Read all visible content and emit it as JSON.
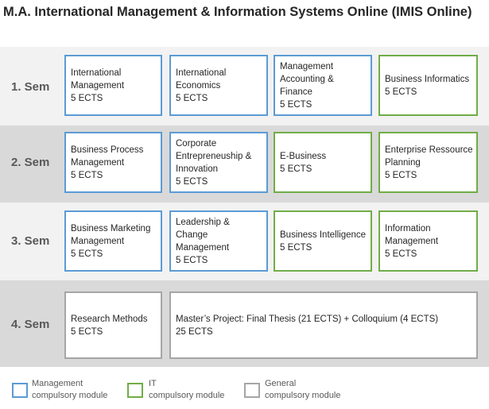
{
  "title": "M.A. International Management & Information Systems Online (IMIS Online)",
  "colors": {
    "management": "#5b9bd5",
    "it": "#70ad47",
    "general": "#a6a6a6",
    "band_light": "#f2f2f2",
    "band_dark": "#d9d9d9"
  },
  "semesters": [
    {
      "label": "1. Sem",
      "modules": [
        {
          "type": "management",
          "name": "International Management",
          "ects": "5 ECTS"
        },
        {
          "type": "management",
          "name": "International Economics",
          "ects": "5 ECTS"
        },
        {
          "type": "management",
          "name": "Management Accounting & Finance",
          "ects": "5 ECTS"
        },
        {
          "type": "it",
          "name": "Business Informatics",
          "ects": "5 ECTS"
        }
      ]
    },
    {
      "label": "2. Sem",
      "modules": [
        {
          "type": "management",
          "name": "Business Process Management",
          "ects": "5 ECTS"
        },
        {
          "type": "management",
          "name": "Corporate Entrepreneuship & Innovation",
          "ects": "5 ECTS"
        },
        {
          "type": "it",
          "name": "E-Business",
          "ects": "5 ECTS"
        },
        {
          "type": "it",
          "name": "Enterprise Ressource Planning",
          "ects": "5 ECTS"
        }
      ]
    },
    {
      "label": "3. Sem",
      "modules": [
        {
          "type": "management",
          "name": "Business Marketing Management",
          "ects": "5 ECTS"
        },
        {
          "type": "management",
          "name": "Leadership & Change Management",
          "ects": "5 ECTS"
        },
        {
          "type": "it",
          "name": "Business Intelligence",
          "ects": "5 ECTS"
        },
        {
          "type": "it",
          "name": "Information Management",
          "ects": "5 ECTS"
        }
      ]
    },
    {
      "label": "4. Sem",
      "modules": [
        {
          "type": "general",
          "name": "Research Methods",
          "ects": "5 ECTS"
        },
        {
          "type": "general",
          "name": "Master’s Project: Final Thesis (21 ECTS) + Colloquium (4 ECTS)",
          "ects": "25 ECTS"
        }
      ]
    }
  ],
  "legend": [
    {
      "type": "management",
      "line1": "Management",
      "line2": "compulsory module"
    },
    {
      "type": "it",
      "line1": "IT",
      "line2": "compulsory module"
    },
    {
      "type": "general",
      "line1": "General",
      "line2": "compulsory module"
    }
  ]
}
